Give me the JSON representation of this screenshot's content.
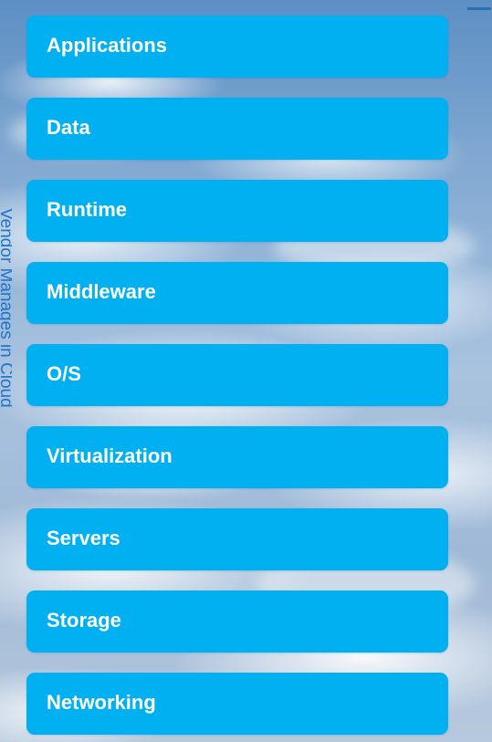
{
  "side_label": "Vendor Manages in Cloud",
  "layers": [
    {
      "label": "Applications"
    },
    {
      "label": "Data"
    },
    {
      "label": "Runtime"
    },
    {
      "label": "Middleware"
    },
    {
      "label": "O/S"
    },
    {
      "label": "Virtualization"
    },
    {
      "label": "Servers"
    },
    {
      "label": "Storage"
    },
    {
      "label": "Networking"
    }
  ],
  "colors": {
    "layer_fill": "#00b0f0",
    "layer_text": "#ffffff",
    "side_label": "#1f73c9"
  }
}
